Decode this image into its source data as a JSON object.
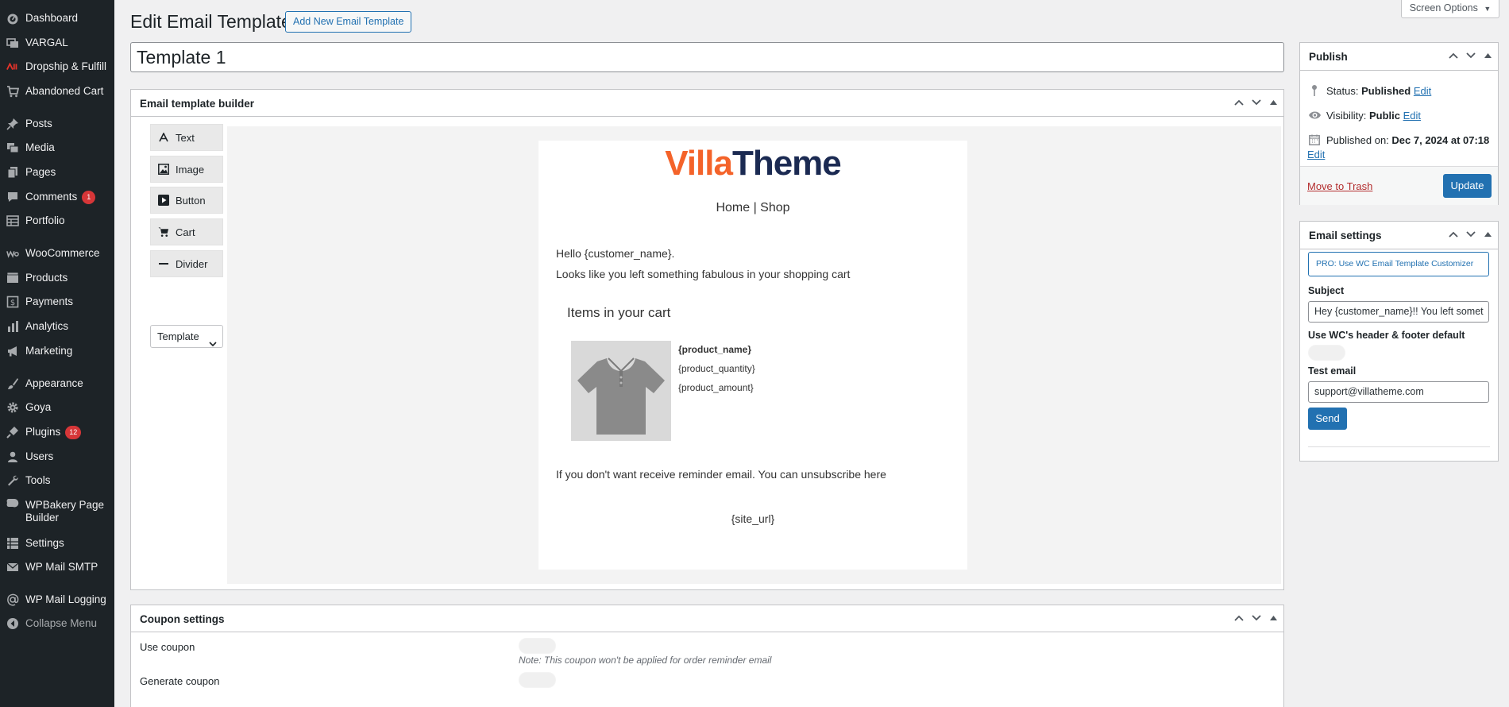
{
  "sidebar": {
    "items": [
      {
        "label": "Dashboard",
        "icon": "dashboard-icon"
      },
      {
        "label": "VARGAL",
        "icon": "layers-icon"
      },
      {
        "label": "Dropship & Fulfill",
        "icon": "ali-logo-icon"
      },
      {
        "label": "Abandoned Cart",
        "icon": "cart-icon"
      },
      {
        "label": "Posts",
        "icon": "pin-icon"
      },
      {
        "label": "Media",
        "icon": "media-icon"
      },
      {
        "label": "Pages",
        "icon": "pages-icon"
      },
      {
        "label": "Comments",
        "icon": "comment-icon",
        "badge": "1"
      },
      {
        "label": "Portfolio",
        "icon": "portfolio-icon"
      },
      {
        "label": "WooCommerce",
        "icon": "woo-icon"
      },
      {
        "label": "Products",
        "icon": "products-icon"
      },
      {
        "label": "Payments",
        "icon": "payments-icon"
      },
      {
        "label": "Analytics",
        "icon": "analytics-icon"
      },
      {
        "label": "Marketing",
        "icon": "megaphone-icon"
      },
      {
        "label": "Appearance",
        "icon": "brush-icon"
      },
      {
        "label": "Goya",
        "icon": "gear-icon"
      },
      {
        "label": "Plugins",
        "icon": "plugin-icon",
        "badge": "12"
      },
      {
        "label": "Users",
        "icon": "user-icon"
      },
      {
        "label": "Tools",
        "icon": "wrench-icon"
      },
      {
        "label": "WPBakery Page",
        "label2": "Builder",
        "icon": "wpbakery-icon"
      },
      {
        "label": "Settings",
        "icon": "settings-icon"
      },
      {
        "label": "WP Mail SMTP",
        "icon": "mail-icon"
      },
      {
        "label": "WP Mail Logging",
        "icon": "at-icon"
      },
      {
        "label": "Collapse Menu",
        "icon": "collapse-icon"
      }
    ]
  },
  "header": {
    "title": "Edit Email Templates",
    "add_new_label": "Add New Email Template",
    "screen_options_label": "Screen Options"
  },
  "post_title": "Template 1",
  "builder": {
    "title": "Email template builder",
    "tools": [
      "Text",
      "Image",
      "Button",
      "Cart",
      "Divider"
    ],
    "template_select": "Template",
    "email": {
      "logo_part1": "Villa",
      "logo_part2": "Theme",
      "nav": "Home | Shop",
      "greeting": "Hello {customer_name}.",
      "message": "Looks like you left something fabulous in your shopping cart",
      "cart_heading": "Items in your cart",
      "product_name": "{product_name}",
      "product_quantity": "{product_quantity}",
      "product_amount": "{product_amount}",
      "unsubscribe": "If you don't want receive reminder email. You can unsubscribe here",
      "site_url": "{site_url}"
    }
  },
  "coupon": {
    "title": "Coupon settings",
    "use_coupon_label": "Use coupon",
    "note": "Note: This coupon won't be applied for order reminder email",
    "generate_coupon_label": "Generate coupon"
  },
  "publish": {
    "title": "Publish",
    "status_label": "Status:",
    "status_value": "Published",
    "visibility_label": "Visibility:",
    "visibility_value": "Public",
    "published_label": "Published on:",
    "published_value": "Dec 7, 2024 at 07:18",
    "edit_label": "Edit",
    "trash_label": "Move to Trash",
    "update_label": "Update"
  },
  "email_settings": {
    "title": "Email settings",
    "pro_label": "PRO: Use WC Email Template Customizer",
    "subject_label": "Subject",
    "subject_value": "Hey {customer_name}!! You left somet",
    "wc_header_label": "Use WC's header & footer default",
    "test_email_label": "Test email",
    "test_email_value": "support@villatheme.com",
    "send_label": "Send"
  },
  "colors": {
    "admin_bar": "#1d2327",
    "primary": "#2271b1",
    "badge": "#d63638",
    "logo_orange": "#f4632a",
    "logo_navy": "#1b2a52"
  }
}
